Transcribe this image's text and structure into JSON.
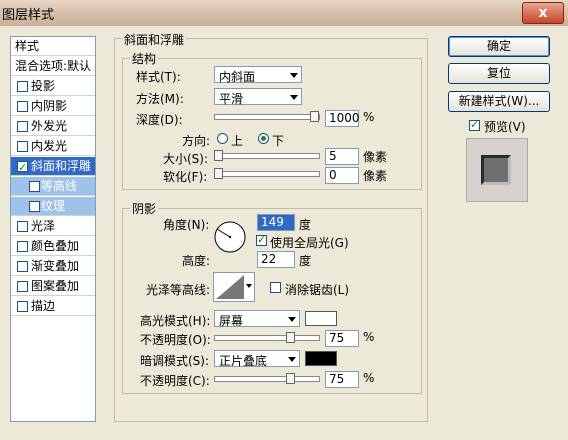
{
  "window": {
    "title": "图层样式",
    "close_glyph": "x"
  },
  "styles_list": {
    "header": "样式",
    "items": [
      {
        "label": "混合选项:默认",
        "checkbox": false,
        "checked": false,
        "state": "normal"
      },
      {
        "label": "投影",
        "checkbox": true,
        "checked": false,
        "state": "normal"
      },
      {
        "label": "内阴影",
        "checkbox": true,
        "checked": false,
        "state": "normal"
      },
      {
        "label": "外发光",
        "checkbox": true,
        "checked": false,
        "state": "normal"
      },
      {
        "label": "内发光",
        "checkbox": true,
        "checked": false,
        "state": "normal"
      },
      {
        "label": "斜面和浮雕",
        "checkbox": true,
        "checked": true,
        "state": "selected"
      },
      {
        "label": "等高线",
        "checkbox": true,
        "checked": false,
        "state": "sub"
      },
      {
        "label": "纹理",
        "checkbox": true,
        "checked": false,
        "state": "sub"
      },
      {
        "label": "光泽",
        "checkbox": true,
        "checked": false,
        "state": "normal"
      },
      {
        "label": "颜色叠加",
        "checkbox": true,
        "checked": false,
        "state": "normal"
      },
      {
        "label": "渐变叠加",
        "checkbox": true,
        "checked": false,
        "state": "normal"
      },
      {
        "label": "图案叠加",
        "checkbox": true,
        "checked": false,
        "state": "normal"
      },
      {
        "label": "描边",
        "checkbox": true,
        "checked": false,
        "state": "normal"
      }
    ]
  },
  "bevel": {
    "title": "斜面和浮雕",
    "structure": {
      "title": "结构",
      "style_label": "样式(T):",
      "style_value": "内斜面",
      "technique_label": "方法(M):",
      "technique_value": "平滑",
      "depth_label": "深度(D):",
      "depth_value": "1000",
      "depth_unit": "%",
      "depth_level": 1.0,
      "direction_label": "方向:",
      "dir_up": "上",
      "dir_down": "下",
      "direction_selected": "down",
      "size_label": "大小(S):",
      "size_value": "5",
      "size_unit": "像素",
      "size_level": 0.0,
      "soften_label": "软化(F):",
      "soften_value": "0",
      "soften_unit": "像素",
      "soften_level": 0.0
    },
    "shading": {
      "title": "阴影",
      "angle_label": "角度(N):",
      "angle_value": "149",
      "angle_unit": "度",
      "global_light_label": "使用全局光(G)",
      "global_light": true,
      "altitude_label": "高度:",
      "altitude_value": "22",
      "altitude_unit": "度",
      "gloss_label": "光泽等高线:",
      "antialias_label": "消除锯齿(L)",
      "antialias": false,
      "highlight_mode_label": "高光模式(H):",
      "highlight_mode_value": "屏幕",
      "highlight_color": "#ffffff",
      "highlight_opacity_label": "不透明度(O):",
      "highlight_opacity_value": "75",
      "highlight_opacity_unit": "%",
      "highlight_opacity_level": 0.75,
      "shadow_mode_label": "暗调模式(S):",
      "shadow_mode_value": "正片叠底",
      "shadow_color": "#000000",
      "shadow_opacity_label": "不透明度(C):",
      "shadow_opacity_value": "75",
      "shadow_opacity_unit": "%",
      "shadow_opacity_level": 0.75
    }
  },
  "buttons": {
    "ok": "确定",
    "reset": "复位",
    "new_style": "新建样式(W)...",
    "preview_label": "预览(V)",
    "preview": true
  },
  "colors": {
    "selection": "#316ac5",
    "sub_selection": "#9ec2ea",
    "dialog_bg": "#ece9d8"
  }
}
